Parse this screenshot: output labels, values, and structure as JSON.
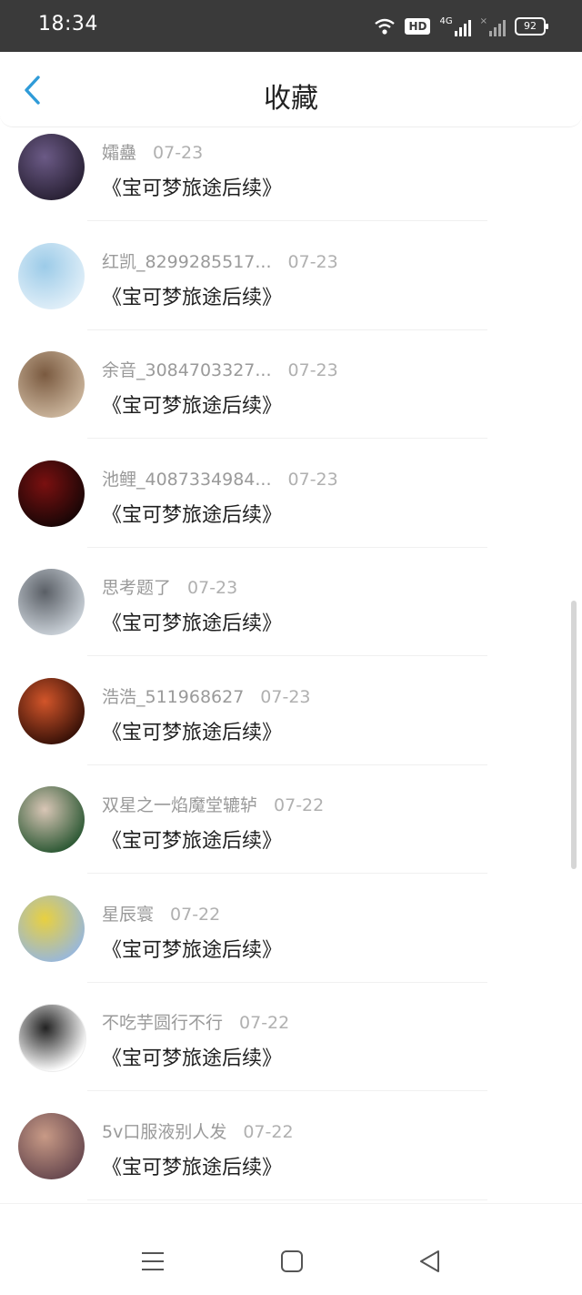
{
  "status_bar": {
    "time": "18:34",
    "hd_label": "HD",
    "network_label": "4G",
    "battery": "92",
    "icons": [
      "wifi-icon",
      "hd-icon",
      "signal-4g-icon",
      "signal-no-sim-icon",
      "battery-icon"
    ]
  },
  "header": {
    "title": "收藏",
    "back_icon": "chevron-left-icon",
    "accent_color": "#2f9bd8"
  },
  "favorites": [
    {
      "user": "孀蠱",
      "date": "07-23",
      "title": "《宝可梦旅途后续》",
      "avatar_colors": [
        "#2a2236",
        "#6b5a86"
      ]
    },
    {
      "user": "红凯_8299285517...",
      "date": "07-23",
      "title": "《宝可梦旅途后续》",
      "avatar_colors": [
        "#dfeef8",
        "#9ccbe8"
      ]
    },
    {
      "user": "余音_3084703327...",
      "date": "07-23",
      "title": "《宝可梦旅途后续》",
      "avatar_colors": [
        "#c9b39a",
        "#7a5a40"
      ]
    },
    {
      "user": "池鲤_4087334984...",
      "date": "07-23",
      "title": "《宝可梦旅途后续》",
      "avatar_colors": [
        "#1a0606",
        "#7a1010"
      ]
    },
    {
      "user": "思考题了",
      "date": "07-23",
      "title": "《宝可梦旅途后续》",
      "avatar_colors": [
        "#c8cfd6",
        "#5a5f66"
      ]
    },
    {
      "user": "浩浩_511968627",
      "date": "07-23",
      "title": "《宝可梦旅途后续》",
      "avatar_colors": [
        "#3a1208",
        "#d2552a"
      ]
    },
    {
      "user": "双星之一焰魔堂辘轳",
      "date": "07-22",
      "title": "《宝可梦旅途后续》",
      "avatar_colors": [
        "#2f5a36",
        "#d9c6b6"
      ]
    },
    {
      "user": "星辰寰",
      "date": "07-22",
      "title": "《宝可梦旅途后续》",
      "avatar_colors": [
        "#9ab8d8",
        "#e8d040"
      ]
    },
    {
      "user": "不吃芋圆行不行",
      "date": "07-22",
      "title": "《宝可梦旅途后续》",
      "avatar_colors": [
        "#ffffff",
        "#222222"
      ]
    },
    {
      "user": "5v口服液别人发",
      "date": "07-22",
      "title": "《宝可梦旅途后续》",
      "avatar_colors": [
        "#6a4a50",
        "#c89a86"
      ]
    }
  ],
  "nav_bar": {
    "icons": [
      "menu-icon",
      "home-square-icon",
      "back-triangle-icon"
    ]
  }
}
